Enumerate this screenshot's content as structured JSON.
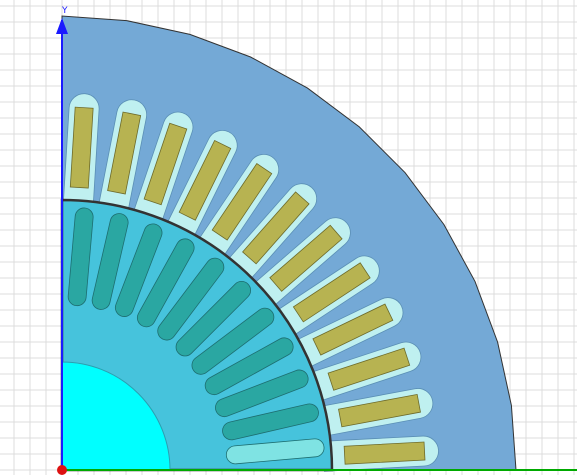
{
  "viewport": {
    "axis_labels": {
      "y": "Y"
    },
    "grid": "on",
    "colors": {
      "background": "#ffffff",
      "grid": "#dcdcdc",
      "stator_core": "#74a9d6",
      "stator_outline": "#333333",
      "stator_slot": "#bff0f0",
      "winding": "#b7b351",
      "rotor_core": "#46c3dc",
      "rotor_bar": "#2aa7a2",
      "shaft": "#00ffff",
      "air_gap_line": "#333333",
      "y_axis": "#1a1aff",
      "x_axis": "#00aa00",
      "origin": "#dd1111"
    },
    "stator_slot_count_visible": 12,
    "rotor_bar_count_visible": 11
  }
}
